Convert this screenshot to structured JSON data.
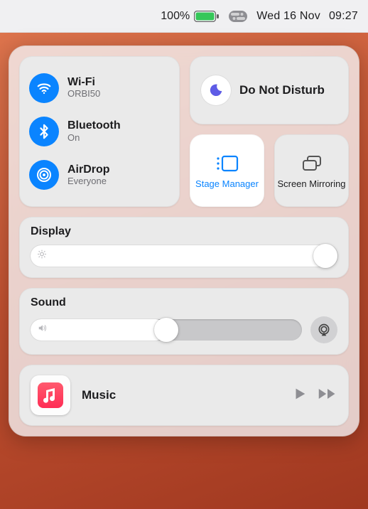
{
  "menu_bar": {
    "battery_percent": "100%",
    "date": "Wed 16 Nov",
    "time": "09:27"
  },
  "control_center": {
    "connectivity": {
      "wifi": {
        "title": "Wi-Fi",
        "subtitle": "ORBI50",
        "active": true
      },
      "bluetooth": {
        "title": "Bluetooth",
        "subtitle": "On",
        "active": true
      },
      "airdrop": {
        "title": "AirDrop",
        "subtitle": "Everyone",
        "active": true
      }
    },
    "focus": {
      "title": "Do Not Disturb"
    },
    "stage_manager": {
      "label": "Stage Manager",
      "active": true
    },
    "screen_mirroring": {
      "label": "Screen Mirroring",
      "active": false
    },
    "display": {
      "label": "Display",
      "brightness_percent": 100
    },
    "sound": {
      "label": "Sound",
      "volume_percent": 50
    },
    "now_playing": {
      "app": "Music",
      "title": "Music"
    }
  }
}
